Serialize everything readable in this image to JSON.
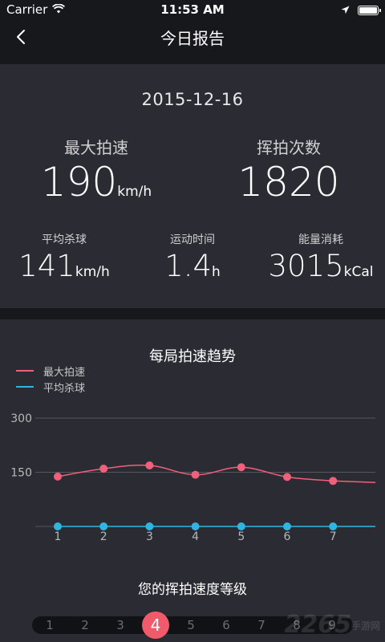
{
  "status_bar": {
    "carrier": "Carrier",
    "time": "11:53 AM",
    "battery_level": 1.0
  },
  "nav": {
    "title": "今日报告",
    "back_icon": "chevron-left-icon"
  },
  "summary": {
    "date": "2015-12-16",
    "max_speed": {
      "label": "最大拍速",
      "value": "190",
      "unit": "km/h"
    },
    "swing_count": {
      "label": "挥拍次数",
      "value": "1820"
    },
    "avg_smash": {
      "label": "平均杀球",
      "value": "141",
      "unit": "km/h"
    },
    "exercise_time": {
      "label": "运动时间",
      "value": "1.4",
      "unit": "h"
    },
    "calories": {
      "label": "能量消耗",
      "value": "3015",
      "unit": "kCal"
    }
  },
  "trend": {
    "title": "每局拍速趋势",
    "legend": {
      "max": "最大拍速",
      "avg": "平均杀球"
    },
    "colors": {
      "max": "#f0607a",
      "avg": "#2fb6e0",
      "grid": "#55565e",
      "axis_text": "#b8b8b8"
    }
  },
  "chart_data": {
    "type": "line",
    "x": [
      1,
      2,
      3,
      4,
      5,
      6,
      7
    ],
    "ylim": [
      0,
      300
    ],
    "yticks": [
      150,
      300
    ],
    "series": [
      {
        "name": "最大拍速",
        "values": [
          138,
          160,
          169,
          143,
          164,
          137,
          126
        ]
      },
      {
        "name": "平均杀球",
        "values": [
          0,
          0,
          0,
          0,
          0,
          0,
          0
        ]
      }
    ],
    "legend_position": "top-left",
    "grid": true
  },
  "level": {
    "title": "您的挥拍速度等级",
    "levels": [
      "1",
      "2",
      "3",
      "4",
      "5",
      "6",
      "7",
      "8",
      "9"
    ],
    "current": 4,
    "accent": "#ef5b6a"
  },
  "watermark": {
    "text": "2265",
    "suffix": "手游网"
  }
}
